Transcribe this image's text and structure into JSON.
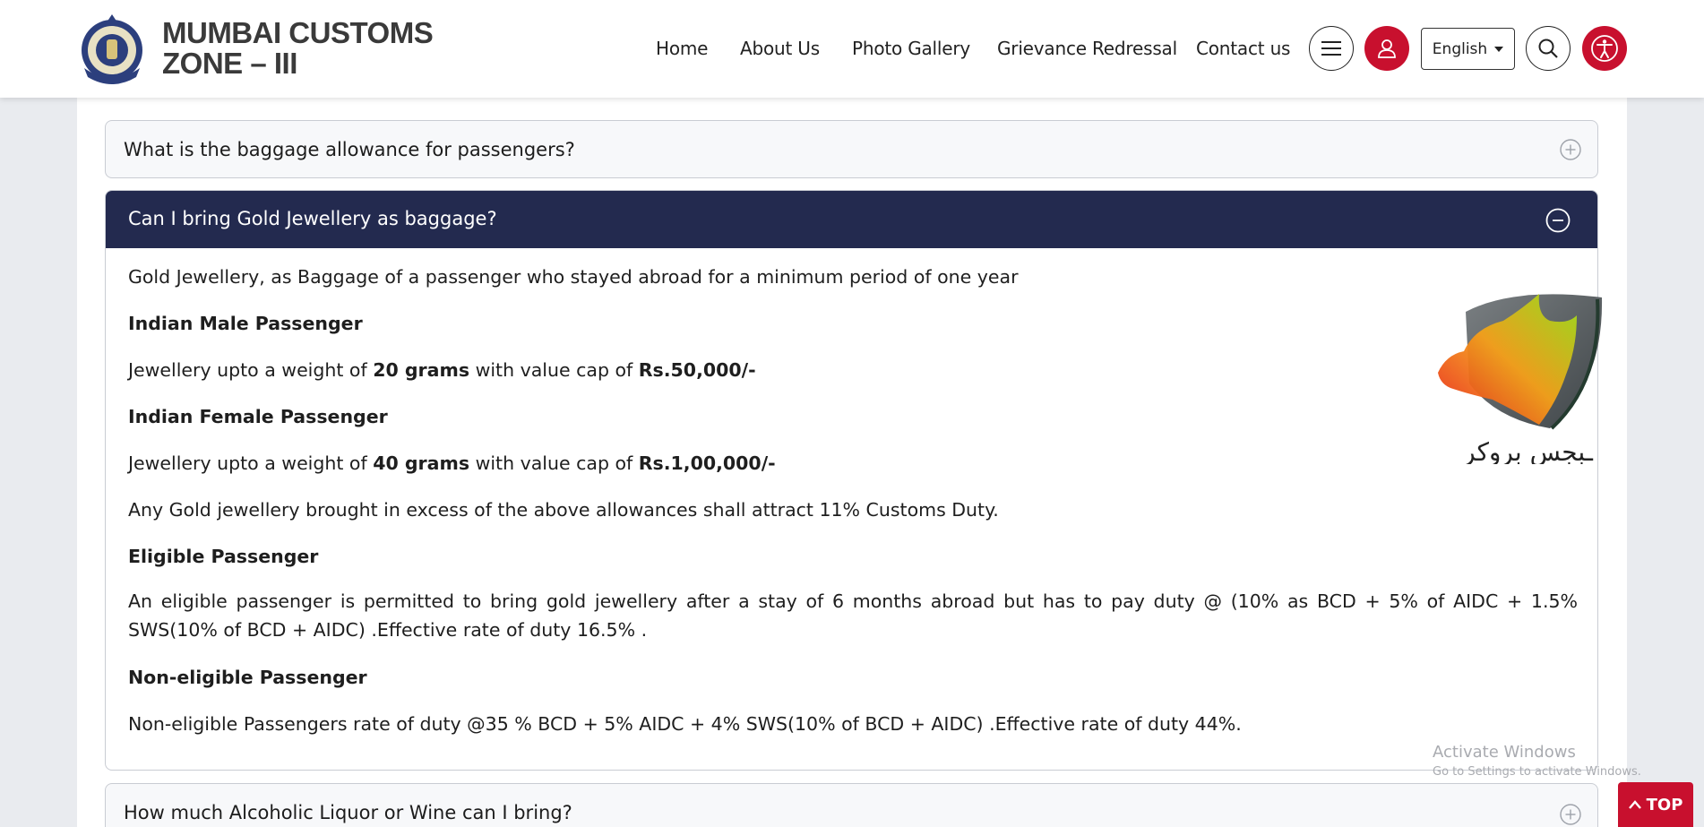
{
  "brand": {
    "line1": "MUMBAI CUSTOMS",
    "line2": "ZONE – III",
    "emblem_icon": "customs-emblem-icon"
  },
  "nav": {
    "items": [
      {
        "label": "Home"
      },
      {
        "label": "About Us"
      },
      {
        "label": "Photo Gallery"
      },
      {
        "label": "Grievance Redressal"
      },
      {
        "label": "Contact us"
      }
    ],
    "language": "English",
    "icons": [
      "hamburger-menu-icon",
      "user-icon",
      "search-icon",
      "accessibility-icon"
    ]
  },
  "faq": {
    "q1": "What is the baggage allowance for passengers?",
    "q2": "Can I bring Gold Jewellery as baggage?",
    "q3": "How much Alcoholic Liquor or Wine can I bring?",
    "answer": {
      "intro": "Gold Jewellery, as Baggage of a passenger who stayed abroad for a minimum period of one year",
      "male_heading": "Indian Male Passenger",
      "male_pre": "Jewellery upto a weight of ",
      "male_weight": "20 grams",
      "male_mid": " with value cap of ",
      "male_cap": "Rs.50,000/-",
      "female_heading": "Indian Female Passenger",
      "female_pre": "Jewellery upto a weight of ",
      "female_weight": "40 grams",
      "female_mid": " with value cap of ",
      "female_cap": "Rs.1,00,000/-",
      "excess": "Any Gold jewellery brought in excess of the above allowances shall attract 11% Customs Duty.",
      "eligible_heading": "Eligible Passenger",
      "eligible_text": "An eligible passenger is permitted to bring gold jewellery after a stay of 6 months abroad but has to pay duty @ (10% as BCD + 5% of AIDC + 1.5% SWS(10% of BCD + AIDC) .Effective rate of duty 16.5% .",
      "noneligible_heading": "Non-eligible Passenger",
      "noneligible_text": "Non-eligible Passengers rate of duty @35 % BCD + 5% AIDC + 4% SWS(10% of BCD + AIDC) .Effective rate of duty 44%."
    }
  },
  "overlay": {
    "watermark_text": "ـبجس بروكر",
    "activate_title": "Activate Windows",
    "activate_sub": "Go to Settings to activate Windows.",
    "top_button": "TOP"
  },
  "colors": {
    "accent_red": "#c8102e",
    "accordion_active": "#232a4f"
  }
}
